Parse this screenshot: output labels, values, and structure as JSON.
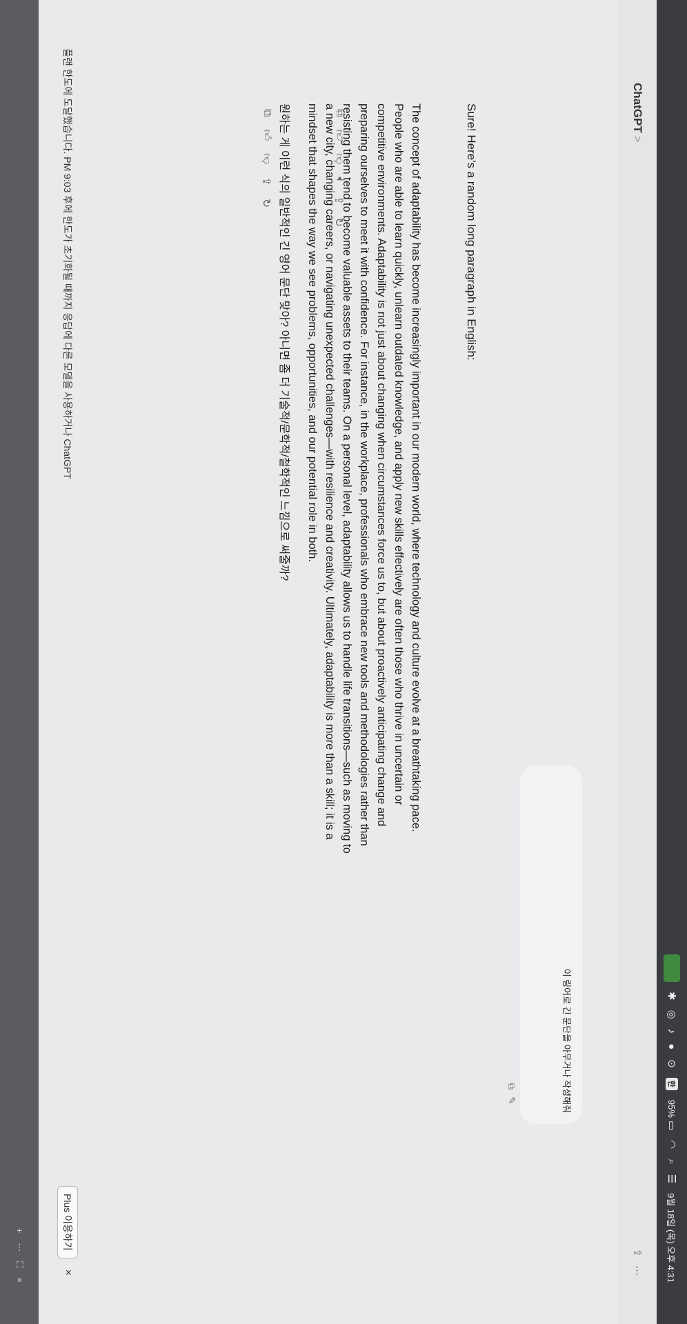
{
  "menubar": {
    "datetime": "9월 18일 (목) 오후 4:31",
    "battery": "95%",
    "badge": "한"
  },
  "app": {
    "name": "ChatGPT",
    "chevron": ">"
  },
  "user_message": {
    "text": "이 링어로 긴 문단을 아무거나 작성해줘"
  },
  "assistant": {
    "intro": "Sure! Here's a random long paragraph in English:",
    "paragraph": "The concept of adaptability has become increasingly important in our modern world, where technology and culture evolve at a breathtaking pace. People who are able to learn quickly, unlearn outdated knowledge, and apply new skills effectively are often those who thrive in uncertain or competitive environments. Adaptability is not just about changing when circumstances force us to, but about proactively anticipating change and preparing ourselves to meet it with confidence. For instance, in the workplace, professionals who embrace new tools and methodologies rather than resisting them tend to become valuable assets to their teams. On a personal level, adaptability allows us to handle life transitions—such as moving to a new city, changing careers, or navigating unexpected challenges—with resilience and creativity. Ultimately, adaptability is more than a skill; it is a mindset that shapes the way we see problems, opportunities, and our potential role in both."
  },
  "followup": {
    "text": "원하는 게 이런 식의 일반적인 긴 영어 문단 맞아? 아니면 좀 더 기술적/문학적/철학적인 느낌으로 써줄까?"
  },
  "banner": {
    "text": "플랜 한도에 도달했습니다. PM 9:03 후에 한도가 초기화될 때까지 응답에 다른 모델을 사용하거나 ChatGPT",
    "button": "Plus 이용하기",
    "close": "×"
  },
  "icons": {
    "copy": "copy-icon",
    "thumbs_up": "thumbs-up-icon",
    "thumbs_down": "thumbs-down-icon",
    "speaker": "speaker-icon",
    "share": "share-icon",
    "refresh": "refresh-icon"
  }
}
